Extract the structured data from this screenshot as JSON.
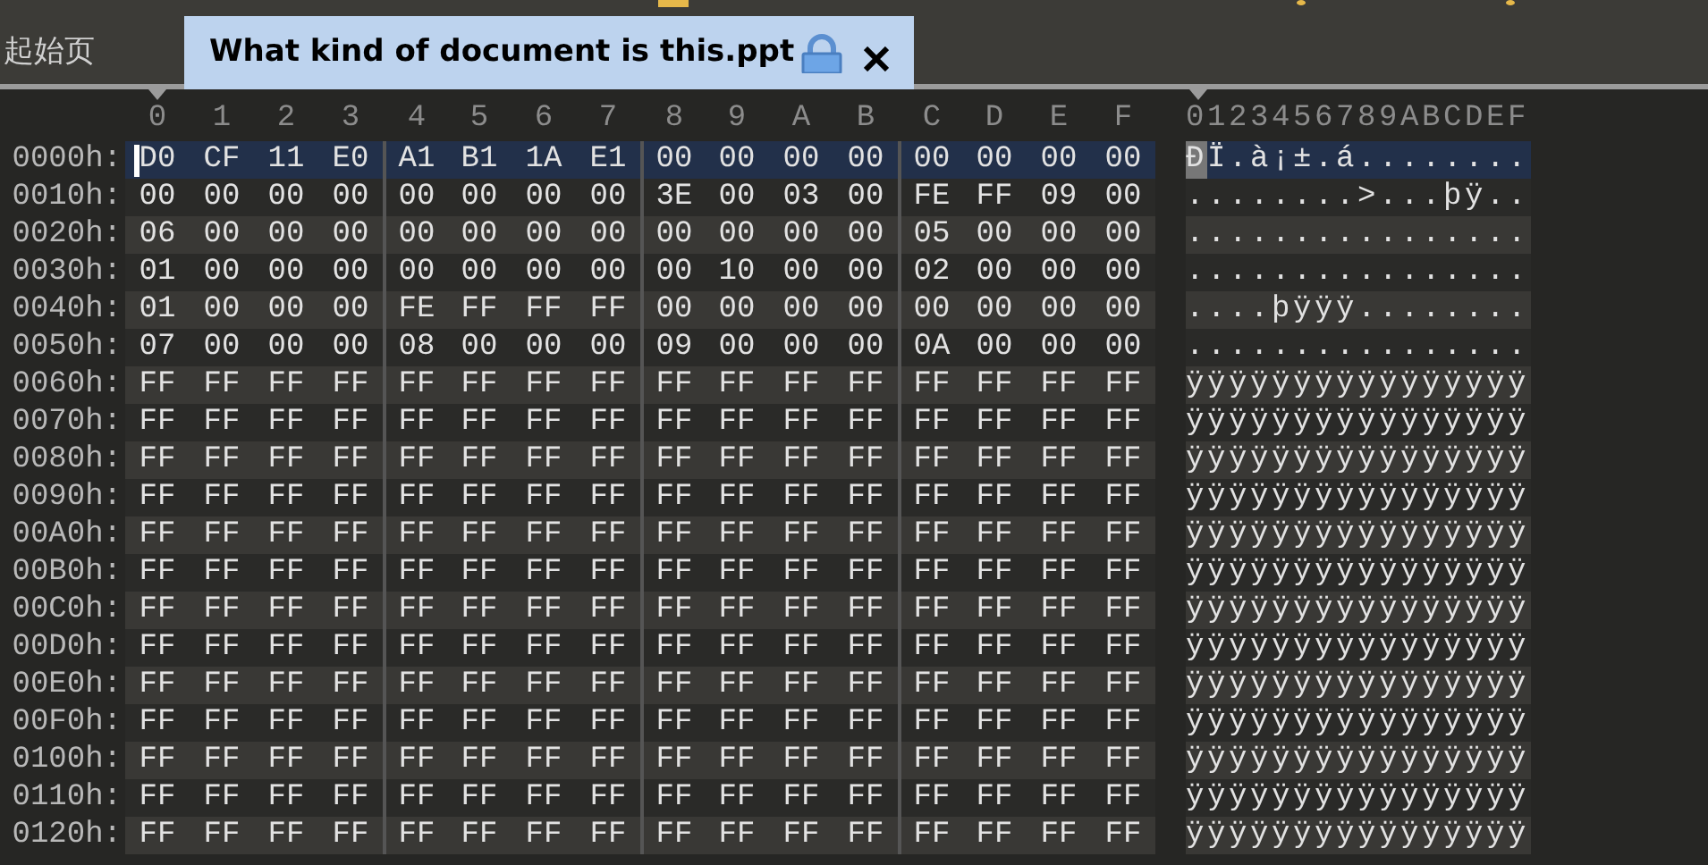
{
  "tabs": [
    {
      "label": "起始页",
      "selected": false,
      "locked": false
    },
    {
      "label": "What kind of document is this.ppt",
      "selected": true,
      "locked": true
    }
  ],
  "offset_columns": [
    "0",
    "1",
    "2",
    "3",
    "4",
    "5",
    "6",
    "7",
    "8",
    "9",
    "A",
    "B",
    "C",
    "D",
    "E",
    "F"
  ],
  "ascii_header": "0123456789ABCDEF",
  "rows": [
    {
      "address": "0000h:",
      "bytes": [
        "D0",
        "CF",
        "11",
        "E0",
        "A1",
        "B1",
        "1A",
        "E1",
        "00",
        "00",
        "00",
        "00",
        "00",
        "00",
        "00",
        "00"
      ],
      "ascii": "ÐÏ.à¡±.á........",
      "selected": true,
      "cursor": true
    },
    {
      "address": "0010h:",
      "bytes": [
        "00",
        "00",
        "00",
        "00",
        "00",
        "00",
        "00",
        "00",
        "3E",
        "00",
        "03",
        "00",
        "FE",
        "FF",
        "09",
        "00"
      ],
      "ascii": "........>...þÿ..",
      "selected": false,
      "cursor": false
    },
    {
      "address": "0020h:",
      "bytes": [
        "06",
        "00",
        "00",
        "00",
        "00",
        "00",
        "00",
        "00",
        "00",
        "00",
        "00",
        "00",
        "05",
        "00",
        "00",
        "00"
      ],
      "ascii": "................",
      "selected": false,
      "cursor": false
    },
    {
      "address": "0030h:",
      "bytes": [
        "01",
        "00",
        "00",
        "00",
        "00",
        "00",
        "00",
        "00",
        "00",
        "10",
        "00",
        "00",
        "02",
        "00",
        "00",
        "00"
      ],
      "ascii": "................",
      "selected": false,
      "cursor": false
    },
    {
      "address": "0040h:",
      "bytes": [
        "01",
        "00",
        "00",
        "00",
        "FE",
        "FF",
        "FF",
        "FF",
        "00",
        "00",
        "00",
        "00",
        "00",
        "00",
        "00",
        "00"
      ],
      "ascii": "....þÿÿÿ........",
      "selected": false,
      "cursor": false
    },
    {
      "address": "0050h:",
      "bytes": [
        "07",
        "00",
        "00",
        "00",
        "08",
        "00",
        "00",
        "00",
        "09",
        "00",
        "00",
        "00",
        "0A",
        "00",
        "00",
        "00"
      ],
      "ascii": "................",
      "selected": false,
      "cursor": false
    },
    {
      "address": "0060h:",
      "bytes": [
        "FF",
        "FF",
        "FF",
        "FF",
        "FF",
        "FF",
        "FF",
        "FF",
        "FF",
        "FF",
        "FF",
        "FF",
        "FF",
        "FF",
        "FF",
        "FF"
      ],
      "ascii": "ÿÿÿÿÿÿÿÿÿÿÿÿÿÿÿÿ",
      "selected": false,
      "cursor": false
    },
    {
      "address": "0070h:",
      "bytes": [
        "FF",
        "FF",
        "FF",
        "FF",
        "FF",
        "FF",
        "FF",
        "FF",
        "FF",
        "FF",
        "FF",
        "FF",
        "FF",
        "FF",
        "FF",
        "FF"
      ],
      "ascii": "ÿÿÿÿÿÿÿÿÿÿÿÿÿÿÿÿ",
      "selected": false,
      "cursor": false
    },
    {
      "address": "0080h:",
      "bytes": [
        "FF",
        "FF",
        "FF",
        "FF",
        "FF",
        "FF",
        "FF",
        "FF",
        "FF",
        "FF",
        "FF",
        "FF",
        "FF",
        "FF",
        "FF",
        "FF"
      ],
      "ascii": "ÿÿÿÿÿÿÿÿÿÿÿÿÿÿÿÿ",
      "selected": false,
      "cursor": false
    },
    {
      "address": "0090h:",
      "bytes": [
        "FF",
        "FF",
        "FF",
        "FF",
        "FF",
        "FF",
        "FF",
        "FF",
        "FF",
        "FF",
        "FF",
        "FF",
        "FF",
        "FF",
        "FF",
        "FF"
      ],
      "ascii": "ÿÿÿÿÿÿÿÿÿÿÿÿÿÿÿÿ",
      "selected": false,
      "cursor": false
    },
    {
      "address": "00A0h:",
      "bytes": [
        "FF",
        "FF",
        "FF",
        "FF",
        "FF",
        "FF",
        "FF",
        "FF",
        "FF",
        "FF",
        "FF",
        "FF",
        "FF",
        "FF",
        "FF",
        "FF"
      ],
      "ascii": "ÿÿÿÿÿÿÿÿÿÿÿÿÿÿÿÿ",
      "selected": false,
      "cursor": false
    },
    {
      "address": "00B0h:",
      "bytes": [
        "FF",
        "FF",
        "FF",
        "FF",
        "FF",
        "FF",
        "FF",
        "FF",
        "FF",
        "FF",
        "FF",
        "FF",
        "FF",
        "FF",
        "FF",
        "FF"
      ],
      "ascii": "ÿÿÿÿÿÿÿÿÿÿÿÿÿÿÿÿ",
      "selected": false,
      "cursor": false
    },
    {
      "address": "00C0h:",
      "bytes": [
        "FF",
        "FF",
        "FF",
        "FF",
        "FF",
        "FF",
        "FF",
        "FF",
        "FF",
        "FF",
        "FF",
        "FF",
        "FF",
        "FF",
        "FF",
        "FF"
      ],
      "ascii": "ÿÿÿÿÿÿÿÿÿÿÿÿÿÿÿÿ",
      "selected": false,
      "cursor": false
    },
    {
      "address": "00D0h:",
      "bytes": [
        "FF",
        "FF",
        "FF",
        "FF",
        "FF",
        "FF",
        "FF",
        "FF",
        "FF",
        "FF",
        "FF",
        "FF",
        "FF",
        "FF",
        "FF",
        "FF"
      ],
      "ascii": "ÿÿÿÿÿÿÿÿÿÿÿÿÿÿÿÿ",
      "selected": false,
      "cursor": false
    },
    {
      "address": "00E0h:",
      "bytes": [
        "FF",
        "FF",
        "FF",
        "FF",
        "FF",
        "FF",
        "FF",
        "FF",
        "FF",
        "FF",
        "FF",
        "FF",
        "FF",
        "FF",
        "FF",
        "FF"
      ],
      "ascii": "ÿÿÿÿÿÿÿÿÿÿÿÿÿÿÿÿ",
      "selected": false,
      "cursor": false
    },
    {
      "address": "00F0h:",
      "bytes": [
        "FF",
        "FF",
        "FF",
        "FF",
        "FF",
        "FF",
        "FF",
        "FF",
        "FF",
        "FF",
        "FF",
        "FF",
        "FF",
        "FF",
        "FF",
        "FF"
      ],
      "ascii": "ÿÿÿÿÿÿÿÿÿÿÿÿÿÿÿÿ",
      "selected": false,
      "cursor": false
    },
    {
      "address": "0100h:",
      "bytes": [
        "FF",
        "FF",
        "FF",
        "FF",
        "FF",
        "FF",
        "FF",
        "FF",
        "FF",
        "FF",
        "FF",
        "FF",
        "FF",
        "FF",
        "FF",
        "FF"
      ],
      "ascii": "ÿÿÿÿÿÿÿÿÿÿÿÿÿÿÿÿ",
      "selected": false,
      "cursor": false
    },
    {
      "address": "0110h:",
      "bytes": [
        "FF",
        "FF",
        "FF",
        "FF",
        "FF",
        "FF",
        "FF",
        "FF",
        "FF",
        "FF",
        "FF",
        "FF",
        "FF",
        "FF",
        "FF",
        "FF"
      ],
      "ascii": "ÿÿÿÿÿÿÿÿÿÿÿÿÿÿÿÿ",
      "selected": false,
      "cursor": false
    },
    {
      "address": "0120h:",
      "bytes": [
        "FF",
        "FF",
        "FF",
        "FF",
        "FF",
        "FF",
        "FF",
        "FF",
        "FF",
        "FF",
        "FF",
        "FF",
        "FF",
        "FF",
        "FF",
        "FF"
      ],
      "ascii": "ÿÿÿÿÿÿÿÿÿÿÿÿÿÿÿÿ",
      "selected": false,
      "cursor": false
    }
  ]
}
